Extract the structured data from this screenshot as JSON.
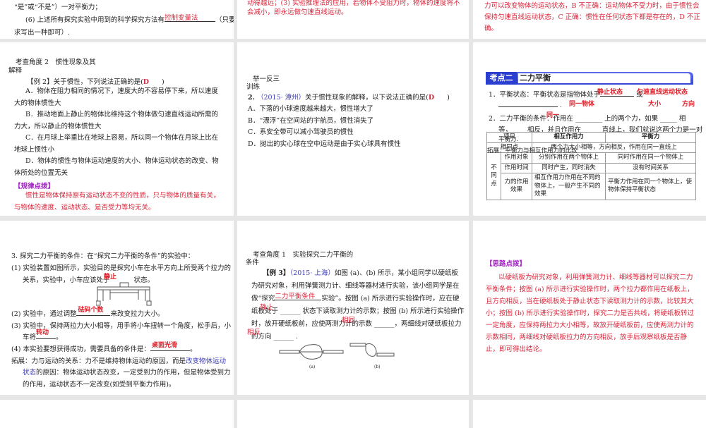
{
  "s1": {
    "l1": "“是”或“不是”）一对平衡力；",
    "l2a": "(6) 上述所有探究实验中用到的科学探究方法有",
    "l2ans": "控制变量法",
    "l2b": "（只要",
    "l3": "求写出一种即可）."
  },
  "s2": {
    "l1": "动得越远；(3) 实验推理法的应用，若物体不受阻力时，物体的速度将不",
    "l2": "会减小，即永远做匀速直线运动。"
  },
  "s3": {
    "l1": "力可以改变物体的运动状态，B 不正确：运动物体不受力时，由于惯性会",
    "l2": "保持匀速直线运动状态，C 正确：惯性在任何状态下都是存在的，D 不正",
    "l3": "确。"
  },
  "s4": {
    "angle": "考查角度 2　惯性现象及其",
    "angle2": "解释",
    "q": "【例 2】关于惯性，下列说法正确的是(",
    "qans": "D",
    "qend": ")",
    "a": "A．物体在阻力相同的情况下，速度大的不容易停下来，所以速度大的物体惯性大",
    "b": "B．推动地面上静止的物体比维持这个物体做匀速直线运动所需的力大，所以静止的物体惯性大",
    "c": "C．在月球上举重比在地球上容易，所以同一个物体在月球上比在地球上惯性小",
    "d": "D．物体的惯性与物体运动速度的大小、物体运动状态的改变、物体所处的位置无关",
    "tip": "【规律点拨】",
    "tiptext": "惯性是物体保持原有运动状态不变的性质，只与物体的质量有关，与物体的速度、运动状态、是否受力等均无关。"
  },
  "s5": {
    "h1": "举一反三",
    "h2": "训练",
    "num": "2.",
    "src": "（2015· 漳州）",
    "q": "关于惯性现象的解释，以下说法正确的是(",
    "qans": "D",
    "qend": ")",
    "a": "A．下落的小球速度越来越大，惯性增大了",
    "b": "B．“漂浮”在空间站的宇航员，惯性消失了",
    "c": "C．系安全带可以减小驾驶员的惯性",
    "d": "D．抛出的实心球在空中运动是由于实心球具有惯性"
  },
  "s6": {
    "badge": "考点二",
    "title": "二力平衡",
    "l1": "1．平衡状态：平衡状态是指物体处于",
    "l1or": "或",
    "ans1": "静止状态",
    "ans2": "匀速直线运动状态",
    "ans3": "同一物体",
    "ans4": "大小",
    "ans5": "方向",
    "ans6": "同一",
    "l2": "2．二力平衡的条件：作用在 ________ 上的两个力，如果 _____ 相",
    "l3": "等，____ 相反，并且作用在 _____ 直线上，我们就说这两个力是一对",
    "l4": "平衡力.",
    "ext": "拓展：平衡力与相互作用力的比较",
    "table": {
      "headers": [
        "项目",
        "相互作用力",
        "平衡力"
      ],
      "same_label": "相同点",
      "same": "两个力大小相等，方向相反，作用在同一直线上",
      "diff_label": "不同点",
      "rows": [
        [
          "作用对象",
          "分别作用在两个物体上",
          "同时作用在同一个物体上"
        ],
        [
          "作用时间",
          "同时产生，同时消失",
          "没有时间关系"
        ],
        [
          "力的作用效果",
          "相互作用力作用在不同的物体上，一般产生不同的效果",
          "平衡力作用在同一个物体上，使物体保持平衡状态"
        ]
      ]
    }
  },
  "s7": {
    "l1": "3. 探究二力平衡的条件：在“探究二力平衡的条件”的实验中：",
    "l2": "(1) 实验装置如图所示，实验目的是探究小车在水平方向上所受两个拉力的",
    "l3a": "关系，实验中，小车应该处于",
    "l3b": "状态。",
    "ans1": "静止",
    "l4a": "(2) 实验中，通过调整",
    "ans2": "砝码个数",
    "l4b": "来改变拉力大小。",
    "l5": "(3) 实验中，保持两拉力大小相等，用手将小车扭转一个角度，松手后，小",
    "l6a": "车将",
    "ans3": "转动",
    "l6b": "。",
    "l7a": "(4) 本实验要想获得成功，需要具备的条件是：",
    "ans4": "桌面光滑",
    "l7b": "。",
    "ext1": "拓展：力与运动的关系：力不是维持物体运动的原因，而是",
    "ext1b": "改变物体运动",
    "ext2a": "状态",
    "ext2b": "的原因：物体运动状态改变，一定受到力的作用，但是物体受到力",
    "ext3": "的作用，运动状态不一定改变(如受到平衡力作用)。"
  },
  "s8": {
    "angle": "考查角度 1　实验探究二力平衡的",
    "angle2": "条件",
    "q1a": "【例 3】",
    "src": "（2015· 上海）",
    "q1b": "如图 (a)、(b) 所示，某小组同学以硬纸板",
    "q2": "为研究对象，利用弹簧测力计、细线等器材进行实验，该小组同学是在",
    "q3a": "做“探究",
    "ans1": "二力平衡条件",
    "q3b": "实验”。按图 (a) 所示进行实验操作时，应在硬",
    "q4": "纸板处于 ______ 状态下读取测力计的示数；按图 (b) 所示进行实验操作",
    "ans2": "静止",
    "q5": "时，放开硬纸板前，应使两测力计的示数 ______，两细线对硬纸板拉力",
    "ans3": "相同",
    "q6": "的方向 ______ .",
    "ans4": "相反",
    "fig_a": "(a)",
    "fig_b": "(b)"
  },
  "s9": {
    "tip": "【思路点拨】",
    "text": "以硬纸板为研究对象，利用弹簧测力计、细线等器材可以探究二力平衡条件；按图 (a) 所示进行实验操作时，两个拉力都作用在纸板上，且方向相反，当在硬纸板处于静止状态下读取测力计的示数，比较其大小；按图 (b) 所示进行实验操作时，探究二力是否共线，将硬纸板转过一定角度，应保持两拉力大小相等，故放开硬纸板前，应使两测力计的示数相同，两细线对硬纸板拉力的方向相反，放手后观察纸板是否静止，即可得出结论。"
  }
}
